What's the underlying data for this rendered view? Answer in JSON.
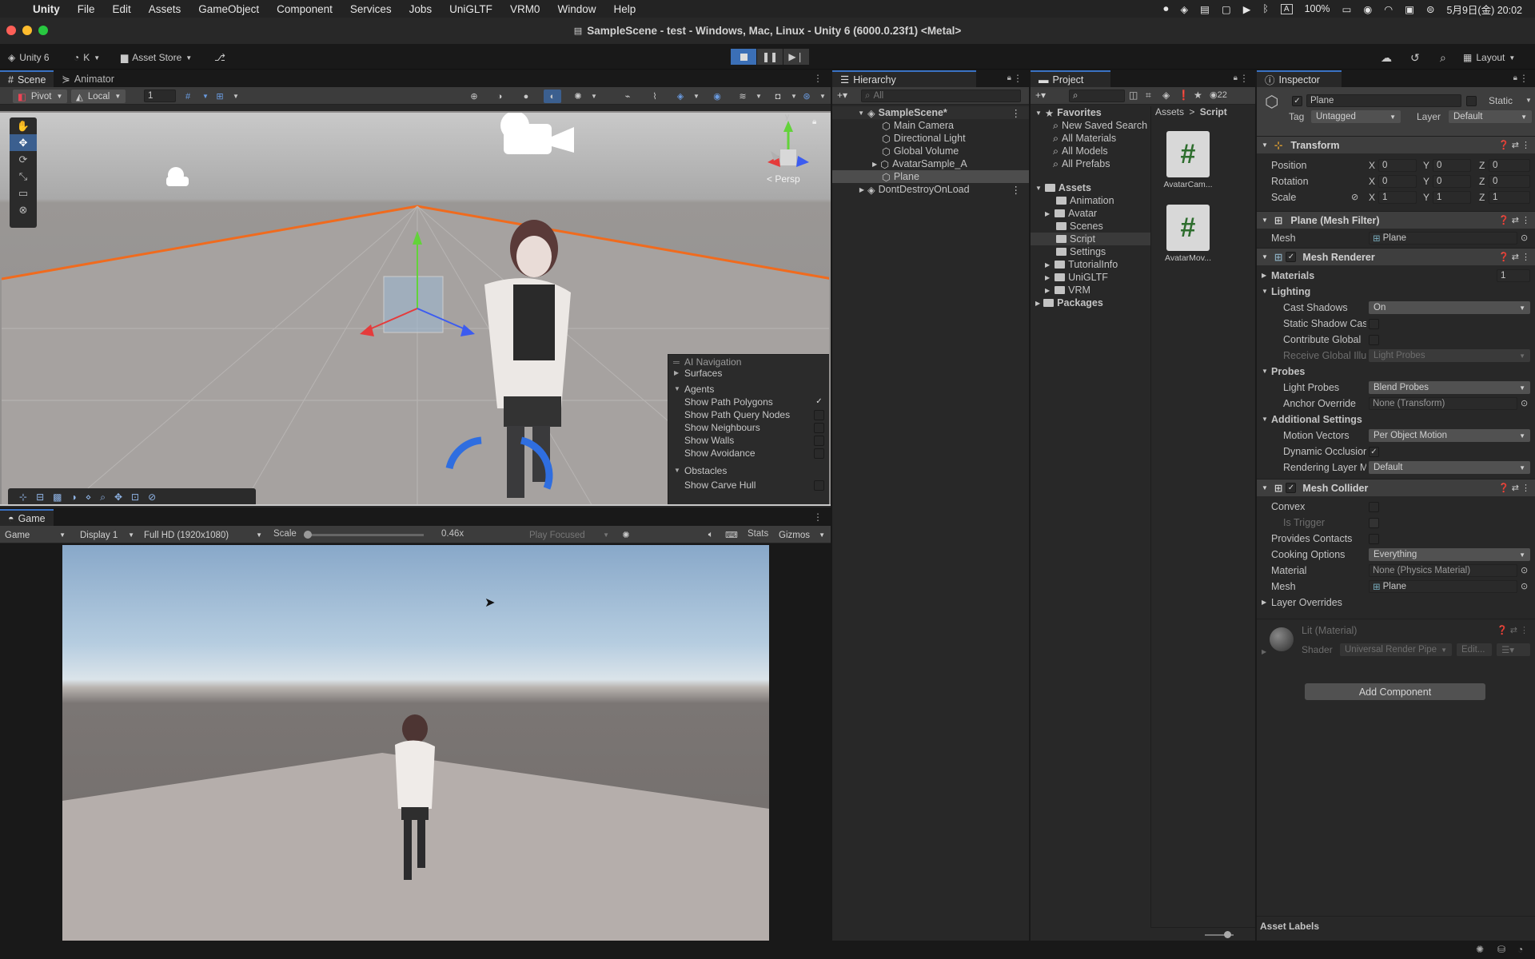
{
  "menubar": {
    "items": [
      "Unity",
      "File",
      "Edit",
      "Assets",
      "GameObject",
      "Component",
      "Services",
      "Jobs",
      "UniGLTF",
      "VRM0",
      "Window",
      "Help"
    ],
    "battery": "100%",
    "datetime": "5月9日(金) 20:02",
    "input_indicator": "A"
  },
  "window": {
    "title": "SampleScene - test - Windows, Mac, Linux - Unity 6 (6000.0.23f1) <Metal>"
  },
  "toolbar": {
    "unity_label": "Unity 6",
    "account": "K",
    "asset_store": "Asset Store",
    "layout": "Layout"
  },
  "scene": {
    "tabs": [
      "Scene",
      "Animator"
    ],
    "pivot": "Pivot",
    "local": "Local",
    "grid_snap": "1",
    "persp": "< Persp",
    "gizmo_axes": [
      "y",
      "x",
      "z"
    ]
  },
  "ai_navigation": {
    "title": "AI Navigation",
    "surfaces": "Surfaces",
    "agents": "Agents",
    "agent_items": [
      {
        "label": "Show Path Polygons",
        "checked": "✓"
      },
      {
        "label": "Show Path Query Nodes",
        "checked": ""
      },
      {
        "label": "Show Neighbours",
        "checked": ""
      },
      {
        "label": "Show Walls",
        "checked": ""
      },
      {
        "label": "Show Avoidance",
        "checked": ""
      }
    ],
    "obstacles": "Obstacles",
    "obstacle_items": [
      {
        "label": "Show Carve Hull",
        "checked": ""
      }
    ]
  },
  "game": {
    "tab": "Game",
    "mode": "Game",
    "display": "Display 1",
    "resolution": "Full HD (1920x1080)",
    "scale_label": "Scale",
    "scale_value": "0.46x",
    "scale_fraction": 0.0,
    "play_focused": "Play Focused",
    "stats": "Stats",
    "gizmos": "Gizmos"
  },
  "hierarchy": {
    "tab": "Hierarchy",
    "search_placeholder": "All",
    "scene": "SampleScene*",
    "items": [
      "Main Camera",
      "Directional Light",
      "Global Volume",
      "AvatarSample_A",
      "Plane"
    ],
    "ddol": "DontDestroyOnLoad"
  },
  "project": {
    "tab": "Project",
    "count": "22",
    "favorites": "Favorites",
    "favorite_items": [
      "New Saved Search",
      "All Materials",
      "All Models",
      "All Prefabs"
    ],
    "assets": "Assets",
    "asset_folders": [
      "Animation",
      "Avatar",
      "Scenes",
      "Script",
      "Settings",
      "TutorialInfo",
      "UniGLTF",
      "VRM"
    ],
    "packages": "Packages",
    "breadcrumb": [
      "Assets",
      "Script"
    ],
    "files": [
      "AvatarCam...",
      "AvatarMov..."
    ]
  },
  "inspector": {
    "tab": "Inspector",
    "object_name": "Plane",
    "static_label": "Static",
    "tag_label": "Tag",
    "tag": "Untagged",
    "layer_label": "Layer",
    "layer": "Default",
    "transform": {
      "title": "Transform",
      "position": {
        "label": "Position",
        "x": "0",
        "y": "0",
        "z": "0"
      },
      "rotation": {
        "label": "Rotation",
        "x": "0",
        "y": "0",
        "z": "0"
      },
      "scale": {
        "label": "Scale",
        "x": "1",
        "y": "1",
        "z": "1"
      }
    },
    "mesh_filter": {
      "title": "Plane (Mesh Filter)",
      "mesh_label": "Mesh",
      "mesh": "Plane"
    },
    "mesh_renderer": {
      "title": "Mesh Renderer",
      "materials": "Materials",
      "materials_count": "1",
      "lighting": "Lighting",
      "cast_shadows_label": "Cast Shadows",
      "cast_shadows": "On",
      "static_shadow_label": "Static Shadow Cas",
      "contribute_gi_label": "Contribute Global",
      "receive_gi_label": "Receive Global Illu",
      "receive_gi": "Light Probes",
      "probes": "Probes",
      "light_probes_label": "Light Probes",
      "light_probes": "Blend Probes",
      "anchor_label": "Anchor Override",
      "anchor": "None (Transform)",
      "additional": "Additional Settings",
      "motion_vectors_label": "Motion Vectors",
      "motion_vectors": "Per Object Motion",
      "dynamic_occlusion_label": "Dynamic Occlusion",
      "rendering_layer_label": "Rendering Layer M",
      "rendering_layer": "Default"
    },
    "mesh_collider": {
      "title": "Mesh Collider",
      "convex": "Convex",
      "is_trigger": "Is Trigger",
      "provides_contacts": "Provides Contacts",
      "cooking_label": "Cooking Options",
      "cooking": "Everything",
      "material_label": "Material",
      "material": "None (Physics Material)",
      "mesh_label": "Mesh",
      "mesh": "Plane",
      "layer_overrides": "Layer Overrides"
    },
    "material": {
      "name": "Lit (Material)",
      "shader_label": "Shader",
      "shader": "Universal Render Pipe",
      "edit": "Edit..."
    },
    "add_component": "Add Component",
    "asset_labels": "Asset Labels"
  }
}
